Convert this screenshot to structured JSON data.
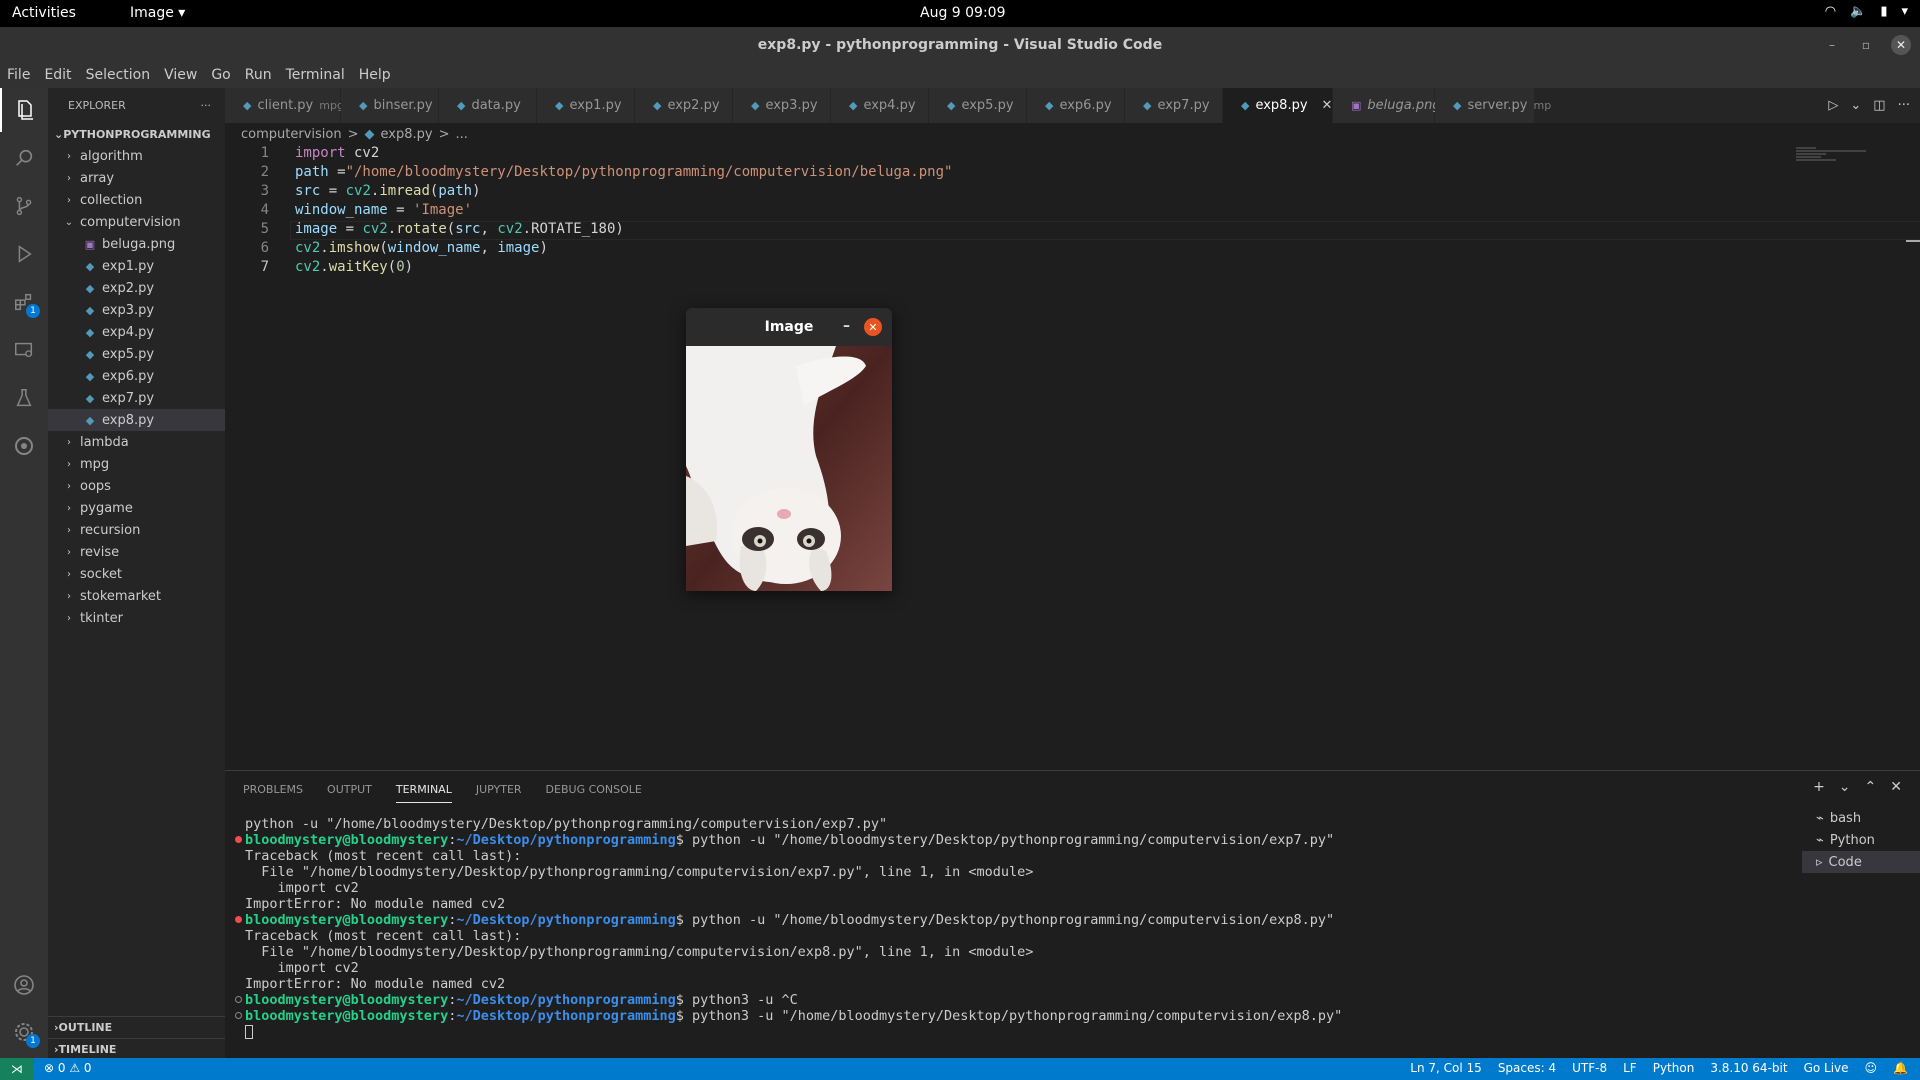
{
  "topbar": {
    "activities": "Activities",
    "app_menu": "Image ▾",
    "clock": "Aug 9  09:09"
  },
  "window": {
    "title": "exp8.py - pythonprogramming - Visual Studio Code"
  },
  "menu": [
    "File",
    "Edit",
    "Selection",
    "View",
    "Go",
    "Run",
    "Terminal",
    "Help"
  ],
  "sidebar": {
    "header": "EXPLORER",
    "root": "PYTHONPROGRAMMING",
    "tree": [
      {
        "label": "algorithm",
        "kind": "folder",
        "open": false
      },
      {
        "label": "array",
        "kind": "folder",
        "open": false
      },
      {
        "label": "collection",
        "kind": "folder",
        "open": false
      },
      {
        "label": "computervision",
        "kind": "folder",
        "open": true
      },
      {
        "label": "beluga.png",
        "kind": "png"
      },
      {
        "label": "exp1.py",
        "kind": "py"
      },
      {
        "label": "exp2.py",
        "kind": "py"
      },
      {
        "label": "exp3.py",
        "kind": "py"
      },
      {
        "label": "exp4.py",
        "kind": "py"
      },
      {
        "label": "exp5.py",
        "kind": "py"
      },
      {
        "label": "exp6.py",
        "kind": "py"
      },
      {
        "label": "exp7.py",
        "kind": "py"
      },
      {
        "label": "exp8.py",
        "kind": "py",
        "selected": true
      },
      {
        "label": "lambda",
        "kind": "folder",
        "open": false
      },
      {
        "label": "mpg",
        "kind": "folder",
        "open": false
      },
      {
        "label": "oops",
        "kind": "folder",
        "open": false
      },
      {
        "label": "pygame",
        "kind": "folder",
        "open": false
      },
      {
        "label": "recursion",
        "kind": "folder",
        "open": false
      },
      {
        "label": "revise",
        "kind": "folder",
        "open": false
      },
      {
        "label": "socket",
        "kind": "folder",
        "open": false
      },
      {
        "label": "stokemarket",
        "kind": "folder",
        "open": false
      },
      {
        "label": "tkinter",
        "kind": "folder",
        "open": false
      }
    ],
    "outline": "OUTLINE",
    "timeline": "TIMELINE"
  },
  "tabs": [
    {
      "label": "client.py",
      "desc": "mpg",
      "kind": "py"
    },
    {
      "label": "binser.py",
      "desc": "",
      "kind": "py"
    },
    {
      "label": "data.py",
      "desc": "",
      "kind": "py"
    },
    {
      "label": "exp1.py",
      "desc": "",
      "kind": "py"
    },
    {
      "label": "exp2.py",
      "desc": "",
      "kind": "py"
    },
    {
      "label": "exp3.py",
      "desc": "",
      "kind": "py"
    },
    {
      "label": "exp4.py",
      "desc": "",
      "kind": "py"
    },
    {
      "label": "exp5.py",
      "desc": "",
      "kind": "py"
    },
    {
      "label": "exp6.py",
      "desc": "",
      "kind": "py"
    },
    {
      "label": "exp7.py",
      "desc": "",
      "kind": "py"
    },
    {
      "label": "exp8.py",
      "desc": "",
      "kind": "py",
      "active": true
    },
    {
      "label": "beluga.png",
      "desc": "",
      "kind": "png",
      "italic": true
    },
    {
      "label": "server.py",
      "desc": "mp",
      "kind": "py"
    }
  ],
  "breadcrumb": [
    "computervision",
    ">",
    "exp8.py",
    ">",
    "..."
  ],
  "code": [
    {
      "n": "1",
      "tokens": [
        [
          "kw",
          "import"
        ],
        [
          "plain",
          " cv2"
        ]
      ]
    },
    {
      "n": "2",
      "tokens": [
        [
          "var",
          "path"
        ],
        [
          "plain",
          " ="
        ],
        [
          "str",
          "\"/home/bloodmystery/Desktop/pythonprogramming/computervision/beluga.png\""
        ]
      ]
    },
    {
      "n": "3",
      "tokens": [
        [
          "var",
          "src"
        ],
        [
          "plain",
          " = "
        ],
        [
          "cls",
          "cv2"
        ],
        [
          "plain",
          "."
        ],
        [
          "fn",
          "imread"
        ],
        [
          "plain",
          "("
        ],
        [
          "var",
          "path"
        ],
        [
          "plain",
          ")"
        ]
      ]
    },
    {
      "n": "4",
      "tokens": [
        [
          "var",
          "window_name"
        ],
        [
          "plain",
          " = "
        ],
        [
          "str",
          "'Image'"
        ]
      ]
    },
    {
      "n": "5",
      "tokens": [
        [
          "var",
          "image"
        ],
        [
          "plain",
          " = "
        ],
        [
          "cls",
          "cv2"
        ],
        [
          "plain",
          "."
        ],
        [
          "fn",
          "rotate"
        ],
        [
          "plain",
          "("
        ],
        [
          "var",
          "src"
        ],
        [
          "plain",
          ", "
        ],
        [
          "cls",
          "cv2"
        ],
        [
          "plain",
          ".ROTATE_180)"
        ]
      ]
    },
    {
      "n": "6",
      "tokens": [
        [
          "cls",
          "cv2"
        ],
        [
          "plain",
          "."
        ],
        [
          "fn",
          "imshow"
        ],
        [
          "plain",
          "("
        ],
        [
          "var",
          "window_name"
        ],
        [
          "plain",
          ", "
        ],
        [
          "var",
          "image"
        ],
        [
          "plain",
          ")"
        ]
      ]
    },
    {
      "n": "7",
      "tokens": [
        [
          "cls",
          "cv2"
        ],
        [
          "plain",
          "."
        ],
        [
          "fn",
          "waitKey"
        ],
        [
          "plain",
          "("
        ],
        [
          "num",
          "0"
        ],
        [
          "plain",
          ")"
        ]
      ]
    }
  ],
  "image_window": {
    "title": "Image",
    "minimize": "–",
    "close": "✕"
  },
  "panel": {
    "tabs": [
      "PROBLEMS",
      "OUTPUT",
      "TERMINAL",
      "JUPYTER",
      "DEBUG CONSOLE"
    ],
    "active_tab": "TERMINAL",
    "terminals": [
      "bash",
      "Python",
      "Code"
    ]
  },
  "terminal_lines": [
    {
      "status": "",
      "parts": [
        [
          "plain",
          "python -u \"/home/bloodmystery/Desktop/pythonprogramming/computervision/exp7.py\""
        ]
      ]
    },
    {
      "status": "err",
      "parts": [
        [
          "user",
          "bloodmystery@bloodmystery"
        ],
        [
          "plain",
          ":"
        ],
        [
          "path",
          "~/Desktop/pythonprogramming"
        ],
        [
          "plain",
          "$ python -u \"/home/bloodmystery/Desktop/pythonprogramming/computervision/exp7.py\""
        ]
      ]
    },
    {
      "status": "",
      "parts": [
        [
          "plain",
          "Traceback (most recent call last):"
        ]
      ]
    },
    {
      "status": "",
      "parts": [
        [
          "plain",
          "  File \"/home/bloodmystery/Desktop/pythonprogramming/computervision/exp7.py\", line 1, in <module>"
        ]
      ]
    },
    {
      "status": "",
      "parts": [
        [
          "plain",
          "    import cv2"
        ]
      ]
    },
    {
      "status": "",
      "parts": [
        [
          "plain",
          "ImportError: No module named cv2"
        ]
      ]
    },
    {
      "status": "err",
      "parts": [
        [
          "user",
          "bloodmystery@bloodmystery"
        ],
        [
          "plain",
          ":"
        ],
        [
          "path",
          "~/Desktop/pythonprogramming"
        ],
        [
          "plain",
          "$ python -u \"/home/bloodmystery/Desktop/pythonprogramming/computervision/exp8.py\""
        ]
      ]
    },
    {
      "status": "",
      "parts": [
        [
          "plain",
          "Traceback (most recent call last):"
        ]
      ]
    },
    {
      "status": "",
      "parts": [
        [
          "plain",
          "  File \"/home/bloodmystery/Desktop/pythonprogramming/computervision/exp8.py\", line 1, in <module>"
        ]
      ]
    },
    {
      "status": "",
      "parts": [
        [
          "plain",
          "    import cv2"
        ]
      ]
    },
    {
      "status": "",
      "parts": [
        [
          "plain",
          "ImportError: No module named cv2"
        ]
      ]
    },
    {
      "status": "ok",
      "parts": [
        [
          "user",
          "bloodmystery@bloodmystery"
        ],
        [
          "plain",
          ":"
        ],
        [
          "path",
          "~/Desktop/pythonprogramming"
        ],
        [
          "plain",
          "$ python3 -u ^C"
        ]
      ]
    },
    {
      "status": "ok",
      "parts": [
        [
          "user",
          "bloodmystery@bloodmystery"
        ],
        [
          "plain",
          ":"
        ],
        [
          "path",
          "~/Desktop/pythonprogramming"
        ],
        [
          "plain",
          "$ python3 -u \"/home/bloodmystery/Desktop/pythonprogramming/computervision/exp8.py\""
        ]
      ]
    }
  ],
  "statusbar": {
    "problems": "⊗ 0 ⚠ 0",
    "position": "Ln 7, Col 15",
    "spaces": "Spaces: 4",
    "encoding": "UTF-8",
    "eol": "LF",
    "language": "Python",
    "interpreter": "3.8.10 64-bit",
    "golive": "Go Live"
  },
  "colors": {
    "accent": "#007acc",
    "error": "#f14c4c",
    "ubuntu_close": "#e95420"
  }
}
